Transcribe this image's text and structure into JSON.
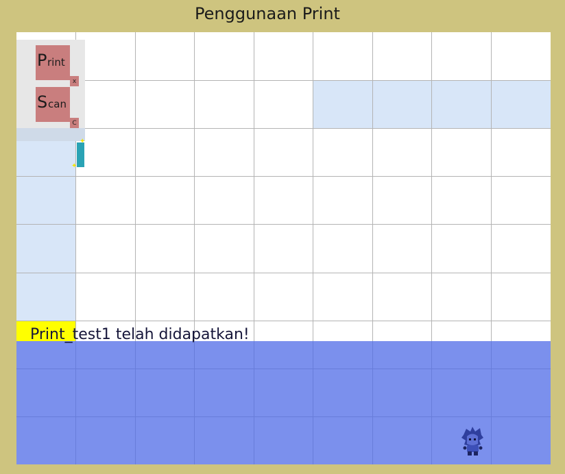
{
  "title": "Penggunaan Print",
  "commands": [
    {
      "letter": "P",
      "rest": "rint",
      "key": "x"
    },
    {
      "letter": "S",
      "rest": "can",
      "key": "C"
    }
  ],
  "message": "Print_test1 telah didapatkan!",
  "icons": {
    "cursor": "cursor-icon",
    "player": "player-sprite-icon",
    "sparkle": "sparkle-icon"
  },
  "colors": {
    "background": "#cec47f",
    "command_card": "#c97e7e",
    "highlight": "#d8e6f8",
    "yellow_tile": "#ffff00",
    "overlay": "#4f6be7",
    "cursor": "#2aa3b5"
  }
}
